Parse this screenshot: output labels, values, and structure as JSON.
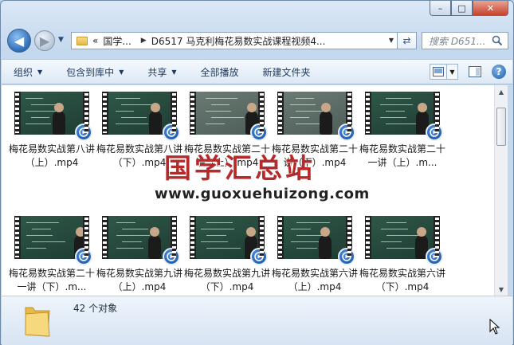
{
  "window": {
    "caption": {
      "minimize": "–",
      "maximize": "□",
      "close": "✕"
    }
  },
  "address_bar": {
    "overflow": "«",
    "segments": [
      "国学...",
      "D6517 马克利梅花易数实战课程视频4..."
    ]
  },
  "search": {
    "placeholder": "搜索 D651..."
  },
  "toolbar": {
    "items": [
      "组织",
      "包含到库中",
      "共享",
      "全部播放",
      "新建文件夹"
    ]
  },
  "files": [
    {
      "name": "梅花易数实战第八讲（上）.mp4",
      "style": "board"
    },
    {
      "name": "梅花易数实战第八讲（下）.mp4",
      "style": "board"
    },
    {
      "name": "梅花易数实战第二十讲（上）.mp4",
      "style": "light"
    },
    {
      "name": "梅花易数实战第二十讲（下）.mp4",
      "style": "light"
    },
    {
      "name": "梅花易数实战第二十一讲（上）.m...",
      "style": "board"
    },
    {
      "name": "梅花易数实战第二十一讲（下）.m...",
      "style": "board"
    },
    {
      "name": "梅花易数实战第九讲（上）.mp4",
      "style": "board"
    },
    {
      "name": "梅花易数实战第九讲（下）.mp4",
      "style": "board"
    },
    {
      "name": "梅花易数实战第六讲（上）.mp4",
      "style": "board"
    },
    {
      "name": "梅花易数实战第六讲（下）.mp4",
      "style": "board"
    }
  ],
  "watermark": {
    "title": "国学汇总站",
    "url": "www.guoxuehuizong.com"
  },
  "status": {
    "count": "42 个对象"
  },
  "colors": {
    "accent": "#2d6cb8",
    "watermark_red": "#b52a2a",
    "board_green": "#2f5848"
  }
}
